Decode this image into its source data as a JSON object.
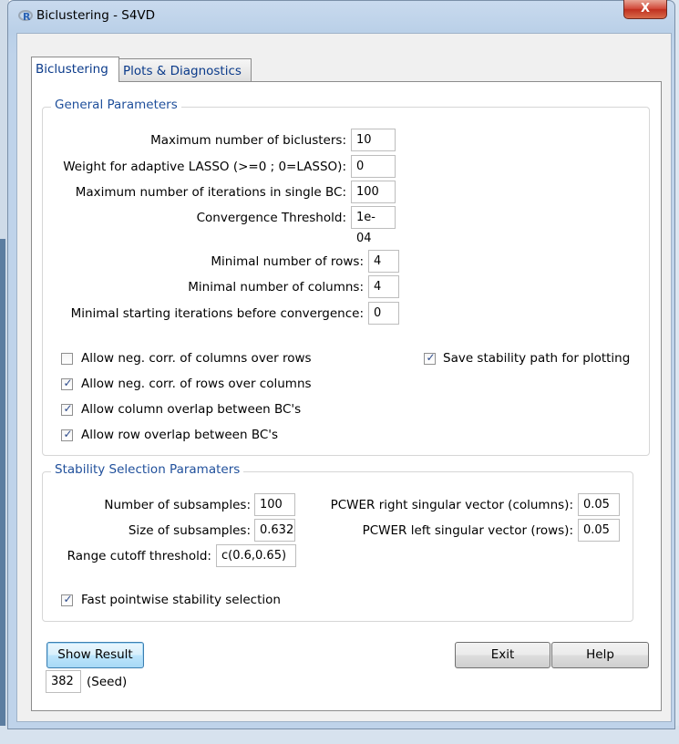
{
  "window": {
    "title": "Biclustering - S4VD",
    "close_label": "X",
    "app_icon": "r-logo-icon"
  },
  "tabs": [
    {
      "label": "Biclustering",
      "active": true
    },
    {
      "label": "Plots & Diagnostics",
      "active": false
    }
  ],
  "general": {
    "title": "General Parameters",
    "fields": [
      {
        "label": "Maximum number of biclusters:",
        "value": "10"
      },
      {
        "label": "Weight for adaptive LASSO (>=0 ; 0=LASSO):",
        "value": "0"
      },
      {
        "label": "Maximum number of iterations in single BC:",
        "value": "100"
      },
      {
        "label": "Convergence Threshold:",
        "value": "1e-04"
      }
    ],
    "fields2": [
      {
        "label": "Minimal number of rows:",
        "value": "4"
      },
      {
        "label": "Minimal number of columns:",
        "value": "4"
      },
      {
        "label": "Minimal starting iterations before convergence:",
        "value": "0"
      }
    ],
    "checkboxes": [
      {
        "label": "Allow neg. corr. of columns over rows",
        "checked": false
      },
      {
        "label": "Allow neg. corr. of rows over columns",
        "checked": true
      },
      {
        "label": "Allow column overlap between BC's",
        "checked": true
      },
      {
        "label": "Allow row overlap between BC's",
        "checked": true
      }
    ],
    "save_path": {
      "label": "Save stability path for plotting",
      "checked": true
    }
  },
  "stability": {
    "title": "Stability Selection Paramaters",
    "left_fields": [
      {
        "label": "Number of subsamples:",
        "value": "100"
      },
      {
        "label": "Size of subsamples:",
        "value": "0.632"
      },
      {
        "label": "Range cutoff threshold:",
        "value": "c(0.6,0.65)"
      }
    ],
    "right_fields": [
      {
        "label": "PCWER right singular vector (columns):",
        "value": "0.05"
      },
      {
        "label": "PCWER left singular vector (rows):",
        "value": "0.05"
      }
    ],
    "fast": {
      "label": "Fast pointwise stability selection",
      "checked": true
    }
  },
  "footer": {
    "show_result": "Show Result",
    "exit": "Exit",
    "help": "Help",
    "seed_value": "382",
    "seed_label": "(Seed)"
  },
  "colors": {
    "group_title": "#1f4f9b",
    "checkmark": "#2c4a8a",
    "close_red": "#c0301f",
    "focus_blue": "#3c7fb1"
  }
}
